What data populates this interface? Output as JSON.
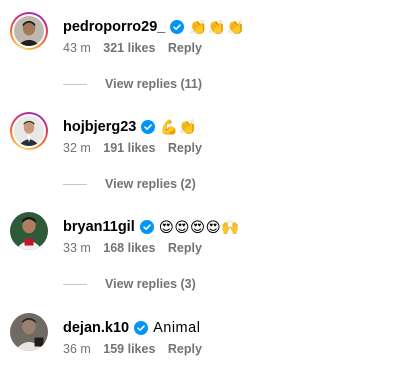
{
  "comments": [
    {
      "username": "pedroporro29_",
      "text": "👏👏👏",
      "time": "43 m",
      "likes": "321 likes",
      "reply": "Reply",
      "view_replies": "View replies (11)"
    },
    {
      "username": "hojbjerg23",
      "text": "💪👏",
      "time": "32 m",
      "likes": "191 likes",
      "reply": "Reply",
      "view_replies": "View replies (2)"
    },
    {
      "username": "bryan11gil",
      "text": "😍😍😍😍🙌",
      "time": "33 m",
      "likes": "168 likes",
      "reply": "Reply",
      "view_replies": "View replies (3)"
    },
    {
      "username": "dejan.k10",
      "text": "Animal",
      "time": "36 m",
      "likes": "159 likes",
      "reply": "Reply"
    }
  ],
  "colors": {
    "verified": "#0095f6",
    "meta_text": "#737373"
  }
}
